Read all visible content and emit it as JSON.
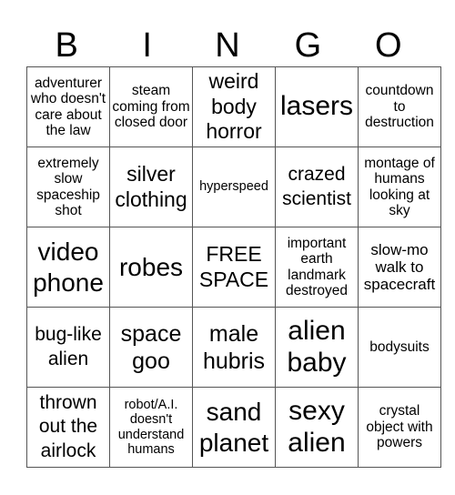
{
  "header": {
    "letters": [
      "B",
      "I",
      "N",
      "G",
      "O"
    ]
  },
  "card": {
    "rows": [
      [
        "adventurer who doesn't care about the law",
        "steam coming from closed door",
        "weird body horror",
        "lasers",
        "countdown to destruction"
      ],
      [
        "extremely slow spaceship shot",
        "silver clothing",
        "hyperspeed",
        "crazed scientist",
        "montage of humans looking at sky"
      ],
      [
        "video phone",
        "robes",
        "FREE SPACE",
        "important earth landmark destroyed",
        "slow-mo walk to spacecraft"
      ],
      [
        "bug-like alien",
        "space goo",
        "male hubris",
        "alien baby",
        "bodysuits"
      ],
      [
        "thrown out the airlock",
        "robot/A.I. doesn't understand humans",
        "sand planet",
        "sexy alien",
        "crystal object with powers"
      ]
    ]
  }
}
